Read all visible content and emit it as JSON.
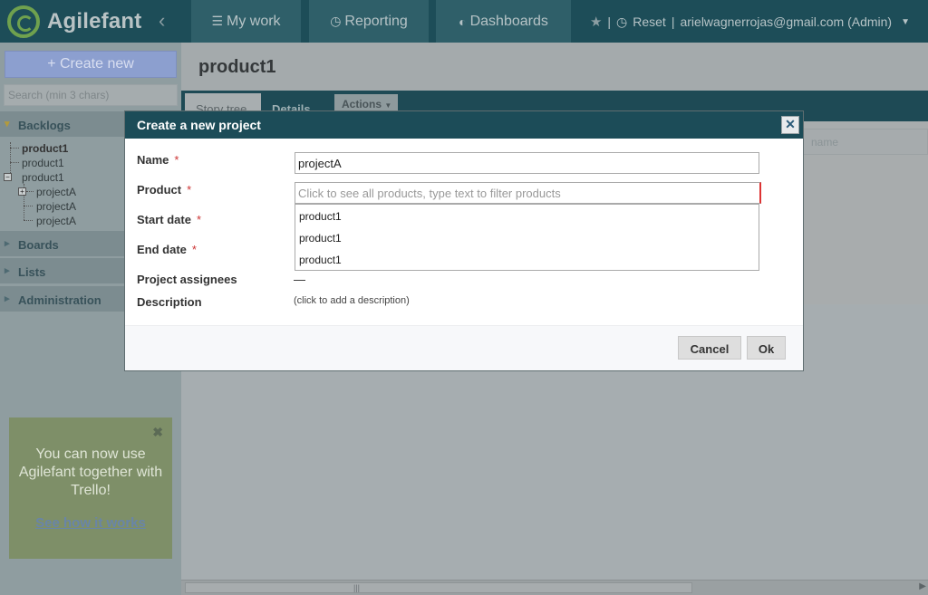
{
  "app": {
    "name": "Agilefant"
  },
  "topnav": {
    "tabs": [
      {
        "label": "My work",
        "icon": "list-icon"
      },
      {
        "label": "Reporting",
        "icon": "clock-icon"
      },
      {
        "label": "Dashboards",
        "icon": "dashboard-icon"
      }
    ],
    "reset_label": "Reset",
    "separator": "|",
    "user": "arielwagnerrojas@gmail.com (Admin)"
  },
  "sidebar": {
    "create_label": "+ Create new",
    "search_placeholder": "Search (min 3 chars)",
    "sections": {
      "backlogs": "Backlogs",
      "boards": "Boards",
      "lists": "Lists",
      "administration": "Administration"
    },
    "tree": [
      "product1",
      "product1",
      "product1",
      "projectA",
      "projectA",
      "projectA"
    ],
    "promo": {
      "text": "You can now use Agilefant together with Trello!",
      "link": "See how it works"
    }
  },
  "main": {
    "title": "product1",
    "tabs": {
      "story_tree": "Story tree",
      "details": "Details",
      "actions": "Actions"
    },
    "filter_placeholder": "name"
  },
  "modal": {
    "title": "Create a new project",
    "fields": {
      "name": "Name",
      "product": "Product",
      "start_date": "Start date",
      "end_date": "End date",
      "assignees": "Project assignees",
      "description": "Description"
    },
    "required_mark": "*",
    "name_value": "projectA",
    "product_placeholder": "Click to see all products, type text to filter products",
    "product_options": [
      "product1",
      "product1",
      "product1"
    ],
    "assignees_value": "—",
    "description_hint": "(click to add a description)",
    "cancel_label": "Cancel",
    "ok_label": "Ok"
  },
  "colors": {
    "header": "#1d4d58",
    "modal_title": "#1c4c58",
    "required": "#cc3333"
  }
}
